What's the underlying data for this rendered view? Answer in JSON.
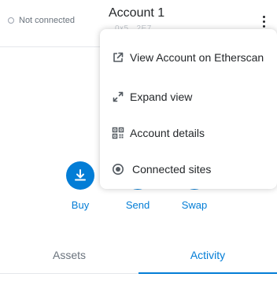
{
  "header": {
    "connection_status": "Not connected",
    "account_name": "Account 1",
    "account_address": "0x5...2E7"
  },
  "actions": [
    {
      "label": "Buy",
      "icon": "download-icon"
    },
    {
      "label": "Send",
      "icon": "send-arrow-icon"
    },
    {
      "label": "Swap",
      "icon": "swap-icon"
    }
  ],
  "tabs": [
    {
      "label": "Assets",
      "active": false
    },
    {
      "label": "Activity",
      "active": true
    }
  ],
  "account_menu": {
    "items": [
      {
        "label": "View Account on Etherscan",
        "icon": "external-link-icon"
      },
      {
        "label": "Expand view",
        "icon": "expand-icon"
      },
      {
        "label": "Account details",
        "icon": "qr-code-icon"
      },
      {
        "label": "Connected sites",
        "icon": "connected-sites-icon"
      }
    ]
  },
  "colors": {
    "accent": "#037dd6",
    "text": "#24272a",
    "muted": "#6a737d"
  }
}
